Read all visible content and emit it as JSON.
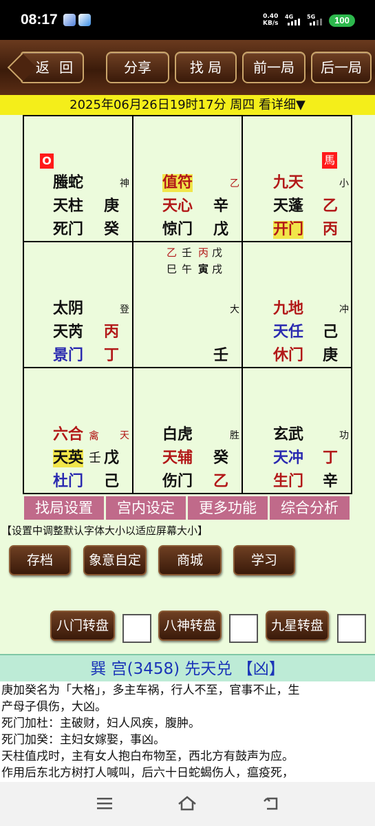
{
  "status_bar": {
    "time": "08:17",
    "net_speed_value": "0.40",
    "net_speed_unit": "KB/s",
    "sig1_label": "4G",
    "sig2_label": "5G",
    "battery": "100"
  },
  "toolbar": {
    "back": "返 回",
    "share": "分享",
    "find": "找 局",
    "prev": "前一局",
    "next": "后一局"
  },
  "date_bar": "2025年06月26日19时17分 周四 看详细▼",
  "palaces": {
    "p1": {
      "marker": "O",
      "god": "螣蛇",
      "god_tag": "神",
      "star": "天柱",
      "star_stem": "庚",
      "door": "死门",
      "door_stem": "癸"
    },
    "p2": {
      "god": "值符",
      "god_tag": "乙",
      "star": "天心",
      "star_stem": "辛",
      "door": "惊门",
      "door_stem": "戊"
    },
    "p3": {
      "marker": "馬",
      "god": "九天",
      "god_tag": "小",
      "star": "天蓬",
      "star_stem": "乙",
      "door": "开门",
      "door_stem": "丙"
    },
    "p4": {
      "god": "太阴",
      "god_tag": "登",
      "star": "天芮",
      "star_stem": "丙",
      "door": "景门",
      "door_stem": "丁"
    },
    "p5": {
      "stems_row1": [
        "乙",
        "壬",
        "丙",
        "戊"
      ],
      "stems_row2": [
        "巳",
        "午",
        "寅",
        "戌"
      ],
      "tag": "大",
      "stem": "壬"
    },
    "p6": {
      "god": "九地",
      "god_tag": "冲",
      "star": "天任",
      "star_stem": "己",
      "door": "休门",
      "door_stem": "庚"
    },
    "p7": {
      "god": "六合",
      "god_extra": "禽",
      "god_tag": "天",
      "star": "天英",
      "star_extra": "壬",
      "star_stem": "戊",
      "door": "杜门",
      "door_stem": "己"
    },
    "p8": {
      "god": "白虎",
      "god_tag": "胜",
      "star": "天辅",
      "star_stem": "癸",
      "door": "伤门",
      "door_stem": "乙"
    },
    "p9": {
      "god": "玄武",
      "god_tag": "功",
      "star": "天冲",
      "star_stem": "丁",
      "door": "生门",
      "door_stem": "辛"
    }
  },
  "func_tabs": [
    "找局设置",
    "宫内设定",
    "更多功能",
    "综合分析"
  ],
  "hint": "【设置中调整默认字体大小以适应屏幕大小】",
  "actions": [
    "存档",
    "象意自定",
    "商城",
    "学习"
  ],
  "rotations": [
    "八门转盘",
    "八神转盘",
    "九星转盘"
  ],
  "info": {
    "title": "巽 宫(3458) 先天兑  【凶】",
    "lines": [
      "庚加癸名为「大格」，多主车祸，行人不至，官事不止，生",
      "产母子俱伤，大凶。",
      "死门加杜：主破财，妇人风疾，腹肿。",
      "死门加癸：主妇女嫁娶，事凶。",
      "天柱值戌时，主有女人抱白布物至，西北方有鼓声为应。",
      "作用后东北方树打人喊叫，后六十日蛇蝎伤人，瘟疫死，"
    ]
  },
  "colors": {
    "accent_red": "#b21818",
    "accent_blue": "#2a2ab0",
    "highlight": "#f1e64a",
    "grid_bg": "#ecfbdc",
    "tab_bg": "#c06a8a"
  }
}
